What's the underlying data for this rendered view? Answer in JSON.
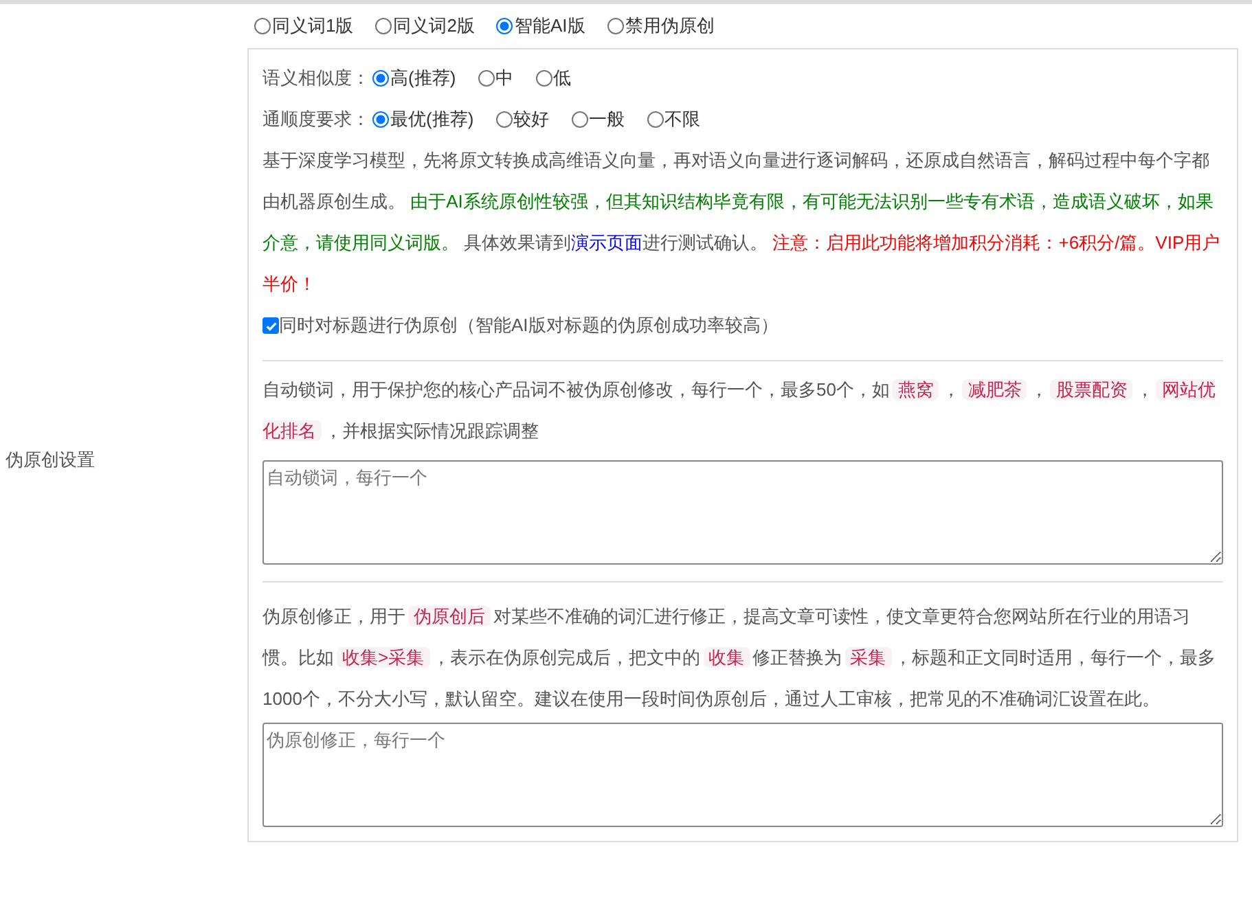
{
  "side_label": "伪原创设置",
  "modes": [
    {
      "label": "同义词1版",
      "selected": false
    },
    {
      "label": "同义词2版",
      "selected": false
    },
    {
      "label": "智能AI版",
      "selected": true
    },
    {
      "label": "禁用伪原创",
      "selected": false
    }
  ],
  "similarity": {
    "label": "语义相似度：",
    "options": [
      {
        "label": "高(推荐)",
        "selected": true
      },
      {
        "label": "中",
        "selected": false
      },
      {
        "label": "低",
        "selected": false
      }
    ]
  },
  "fluency": {
    "label": "通顺度要求：",
    "options": [
      {
        "label": "最优(推荐)",
        "selected": true
      },
      {
        "label": "较好",
        "selected": false
      },
      {
        "label": "一般",
        "selected": false
      },
      {
        "label": "不限",
        "selected": false
      }
    ]
  },
  "description": [
    {
      "kind": "text",
      "text": "基于深度学习模型，先将原文转换成高维语义向量，再对语义向量进行逐词解码，还原成自然语言，解码过程中每个字都由机器原创生成。"
    },
    {
      "kind": "green",
      "text": " 由于AI系统原创性较强，但其知识结构毕竟有限，有可能无法识别一些专有术语，造成语义破坏，如果介意，请使用同义词版。"
    },
    {
      "kind": "text",
      "text": " 具体效果请到"
    },
    {
      "kind": "link",
      "text": "演示页面"
    },
    {
      "kind": "text",
      "text": "进行测试确认。"
    },
    {
      "kind": "red",
      "text": " 注意：启用此功能将增加积分消耗：+6积分/篇。VIP用户半价！"
    }
  ],
  "title_option": {
    "label": "同时对标题进行伪原创（智能AI版对标题的伪原创成功率较高）",
    "checked": true
  },
  "lock_words": {
    "description": [
      {
        "kind": "text",
        "text": "自动锁词，用于保护您的核心产品词不被伪原创修改，每行一个，最多50个，如"
      },
      {
        "kind": "tag",
        "text": "燕窝"
      },
      {
        "kind": "text",
        "text": "，"
      },
      {
        "kind": "tag",
        "text": "减肥茶"
      },
      {
        "kind": "text",
        "text": "，"
      },
      {
        "kind": "tag",
        "text": "股票配资"
      },
      {
        "kind": "text",
        "text": "，"
      },
      {
        "kind": "tag",
        "text": "网站优化排名"
      },
      {
        "kind": "text",
        "text": "，并根据实际情况跟踪调整"
      }
    ],
    "placeholder": "自动锁词，每行一个"
  },
  "correction": {
    "description": [
      {
        "kind": "text",
        "text": "伪原创修正，用于"
      },
      {
        "kind": "tag",
        "text": "伪原创后"
      },
      {
        "kind": "text",
        "text": "对某些不准确的词汇进行修正，提高文章可读性，使文章更符合您网站所在行业的用语习惯。比如"
      },
      {
        "kind": "tag",
        "text": "收集>采集"
      },
      {
        "kind": "text",
        "text": "，表示在伪原创完成后，把文中的"
      },
      {
        "kind": "tag",
        "text": "收集"
      },
      {
        "kind": "text",
        "text": "修正替换为"
      },
      {
        "kind": "tag",
        "text": "采集"
      },
      {
        "kind": "text",
        "text": "，标题和正文同时适用，每行一个，最多1000个，不分大小写，默认留空。建议在使用一段时间伪原创后，通过人工审核，把常见的不准确词汇设置在此。"
      }
    ],
    "placeholder": "伪原创修正，每行一个"
  }
}
